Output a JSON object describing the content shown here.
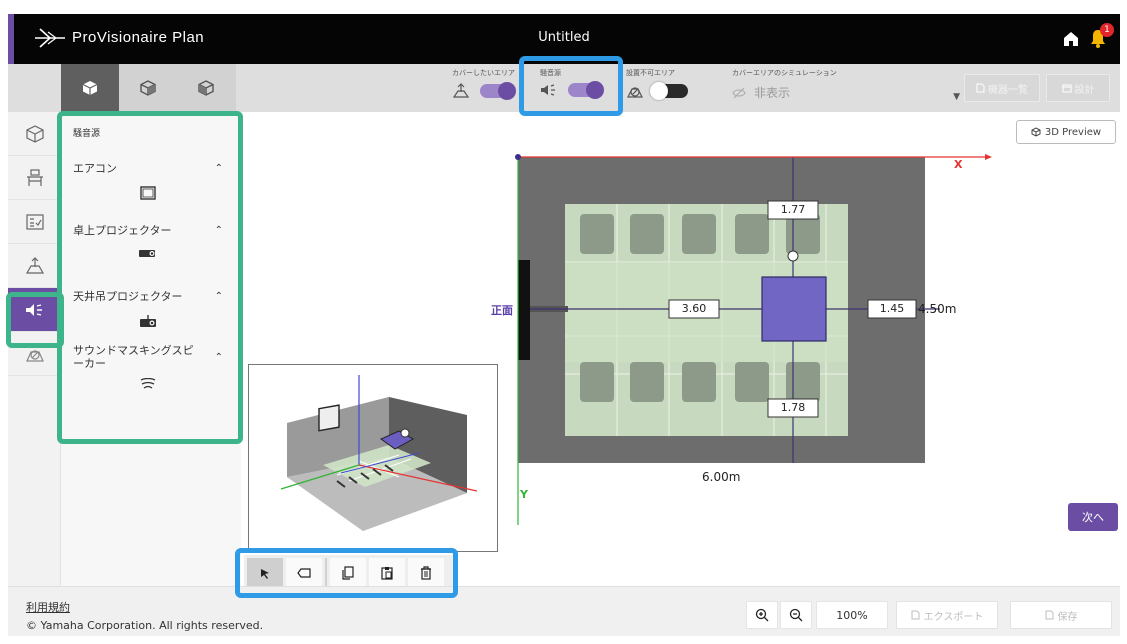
{
  "app": {
    "brand": "ProVisionaire Plan",
    "title": "Untitled",
    "notification_count": "1"
  },
  "toolbar": {
    "toggles": [
      {
        "label": "カバーしたいエリア",
        "state": "on"
      },
      {
        "label": "騒音源",
        "state": "on"
      },
      {
        "label": "設置不可エリア",
        "state": "off"
      }
    ],
    "simulation": {
      "label": "カバーエリアのシミュレーション",
      "value": "非表示"
    },
    "equipment_list_label": "機器一覧",
    "design_label": "設計"
  },
  "rail": {
    "items": [
      {
        "icon": "room-icon"
      },
      {
        "icon": "furniture-icon"
      },
      {
        "icon": "checklist-icon"
      },
      {
        "icon": "coverage-area-icon"
      },
      {
        "icon": "noise-source-icon",
        "active": true
      },
      {
        "icon": "no-install-area-icon"
      }
    ]
  },
  "panel": {
    "title": "騒音源",
    "categories": [
      {
        "label": "エアコン",
        "icon": "air-conditioner-icon"
      },
      {
        "label": "卓上プロジェクター",
        "icon": "desktop-projector-icon"
      },
      {
        "label": "天井吊プロジェクター",
        "icon": "ceiling-projector-icon"
      },
      {
        "label": "サウンドマスキングスピーカー",
        "label_lines": [
          "サウンドマスキングスピ",
          "ーカー"
        ],
        "icon": "sound-masking-speaker-icon"
      }
    ]
  },
  "canvas": {
    "preview_label": "3D Preview",
    "next_label": "次へ",
    "front_label": "正面",
    "axis_x": "X",
    "axis_y": "Y",
    "width_label": "6.00m",
    "depth_label": "4.50m",
    "dimensions": {
      "top": "1.77",
      "left": "3.60",
      "right": "1.45",
      "bottom": "1.78"
    },
    "colors": {
      "noise_source": "#7166c4",
      "coverage": "#cfe3c6",
      "room": "#6d6d6d",
      "axis_x": "#e63333",
      "axis_y": "#33b333"
    }
  },
  "tools": [
    "select-arrow-icon",
    "rotate-icon",
    "copy-icon",
    "paste-icon",
    "delete-icon"
  ],
  "bottom": {
    "terms": "利用規約",
    "copyright": "© Yamaha Corporation. All rights reserved.",
    "zoom": "100%",
    "export_label": "エクスポート",
    "save_label": "保存"
  },
  "colors": {
    "accent": "#6b4ea3",
    "highlight_blue": "#2f9be6",
    "highlight_green": "#3db48a"
  }
}
